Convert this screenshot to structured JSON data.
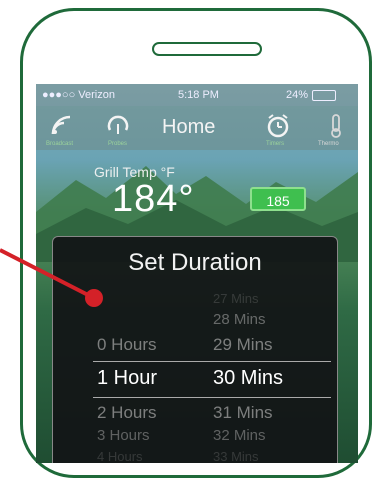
{
  "statusbar": {
    "carrier": "●●●○○ Verizon",
    "time": "5:18 PM",
    "battery": "24%"
  },
  "navbar": {
    "title": "Home",
    "labels": [
      "Broadcast",
      "Probes",
      "Timers",
      "Thermo"
    ]
  },
  "grill": {
    "label": "Grill Temp °F",
    "temp": "184°",
    "setpoint": "185"
  },
  "modal": {
    "title": "Set Duration",
    "rows": [
      {
        "hours": "",
        "mins": "27 Mins"
      },
      {
        "hours": "",
        "mins": "28 Mins"
      },
      {
        "hours": "0 Hours",
        "mins": "29 Mins"
      },
      {
        "hours": "1 Hour",
        "mins": "30 Mins"
      },
      {
        "hours": "2 Hours",
        "mins": "31 Mins"
      },
      {
        "hours": "3 Hours",
        "mins": "32 Mins"
      },
      {
        "hours": "4 Hours",
        "mins": "33 Mins"
      }
    ]
  },
  "colors": {
    "phone_outline": "#1f6a3a",
    "setpoint_green": "#3fbf4f",
    "annotation_red": "#d42128"
  }
}
